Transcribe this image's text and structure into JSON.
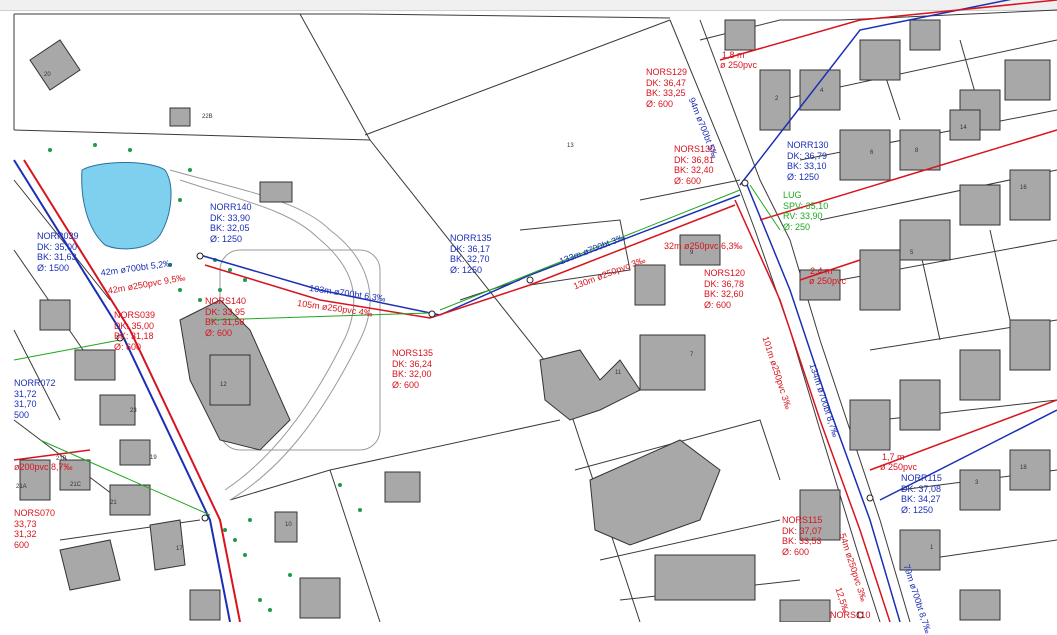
{
  "labels": [
    {
      "id": "norr140",
      "color": "blue",
      "lines": [
        "NORR140",
        "DK: 33,90",
        "BK: 32,05",
        "Ø: 1250"
      ]
    },
    {
      "id": "norr039",
      "color": "blue",
      "lines": [
        "NORR039",
        "DK: 35,00",
        "BK: 31,63",
        "Ø: 1500"
      ]
    },
    {
      "id": "nors140",
      "color": "red",
      "lines": [
        "NORS140",
        "DK: 33,95",
        "BK: 31,58",
        "Ø: 600"
      ]
    },
    {
      "id": "nors039",
      "color": "red",
      "lines": [
        "NORS039",
        "DK: 35,00",
        "BK: 31,18",
        "Ø: 600"
      ]
    },
    {
      "id": "norr072",
      "color": "blue",
      "lines": [
        "NORR072",
        "31,72",
        "31,70",
        "500"
      ]
    },
    {
      "id": "nors070",
      "color": "red",
      "lines": [
        "NORS070",
        "33,73",
        "31,32",
        "600"
      ]
    },
    {
      "id": "norr135",
      "color": "blue",
      "lines": [
        "NORR135",
        "DK: 36,17",
        "BK: 32,70",
        "Ø: 1250"
      ]
    },
    {
      "id": "nors135",
      "color": "red",
      "lines": [
        "NORS135",
        "DK: 36,24",
        "BK: 32,00",
        "Ø: 600"
      ]
    },
    {
      "id": "nors129",
      "color": "red",
      "lines": [
        "NORS129",
        "DK: 36,47",
        "BK: 33,25",
        "Ø: 600"
      ]
    },
    {
      "id": "nors130",
      "color": "red",
      "lines": [
        "NORS130",
        "DK: 36,81",
        "BK: 32,40",
        "Ø: 600"
      ]
    },
    {
      "id": "norr130",
      "color": "blue",
      "lines": [
        "NORR130",
        "DK: 36,79",
        "BK: 33,10",
        "Ø: 1250"
      ]
    },
    {
      "id": "lug",
      "color": "green",
      "lines": [
        "LUG",
        "SPV: 35,10",
        "RV: 33,90",
        "Ø: 250"
      ]
    },
    {
      "id": "nors120",
      "color": "red",
      "lines": [
        "NORS120",
        "DK: 36,78",
        "BK: 32,60",
        "Ø: 600"
      ]
    },
    {
      "id": "nors115",
      "color": "red",
      "lines": [
        "NORS115",
        "DK: 37,07",
        "BK: 33,53",
        "Ø: 600"
      ]
    },
    {
      "id": "norr115",
      "color": "blue",
      "lines": [
        "NORR115",
        "DK: 37,08",
        "BK: 34,27",
        "Ø: 1250"
      ]
    },
    {
      "id": "nors110",
      "color": "red",
      "lines": [
        "NORS110"
      ]
    }
  ],
  "pipe_labels": [
    {
      "id": "p1",
      "color": "blue",
      "text": "42m ø700bt 5,2‰"
    },
    {
      "id": "p2",
      "color": "red",
      "text": "42m ø250pvc 9,5‰"
    },
    {
      "id": "p3",
      "color": "blue",
      "text": "103m ø700bt 6,3‰"
    },
    {
      "id": "p4",
      "color": "red",
      "text": "105m ø250pvc 4‰"
    },
    {
      "id": "p5",
      "color": "blue",
      "text": "133m ø700bt 3‰"
    },
    {
      "id": "p6",
      "color": "red",
      "text": "130m ø250pvc 3‰"
    },
    {
      "id": "p7",
      "color": "red",
      "text": "32m ø250pvc 6,3‰"
    },
    {
      "id": "p8",
      "color": "red",
      "text": "1,8 m"
    },
    {
      "id": "p9",
      "color": "red",
      "text": "ø 250pvc"
    },
    {
      "id": "p10",
      "color": "red",
      "text": "2,4 m"
    },
    {
      "id": "p11",
      "color": "red",
      "text": "ø 250pvc"
    },
    {
      "id": "p12",
      "color": "red",
      "text": "101m ø250pvc 3‰"
    },
    {
      "id": "p13",
      "color": "blue",
      "text": "134m ø700bt 8,7‰"
    },
    {
      "id": "p14",
      "color": "red",
      "text": "1,7 m"
    },
    {
      "id": "p15",
      "color": "red",
      "text": "ø 250pvc"
    },
    {
      "id": "p16",
      "color": "red",
      "text": "ø200pvc 8,7‰"
    },
    {
      "id": "p17",
      "color": "red",
      "text": "54m ø250pvc 3‰"
    },
    {
      "id": "p18",
      "color": "blue",
      "text": "79m ø700bt 8,7‰"
    },
    {
      "id": "p19",
      "color": "blue",
      "text": "94m ø700bt 5‰"
    },
    {
      "id": "p20",
      "color": "red",
      "text": "12,5‰"
    }
  ],
  "house_numbers": [
    "20",
    "22B",
    "13",
    "2",
    "4",
    "6",
    "8",
    "9",
    "7",
    "11",
    "12",
    "10",
    "17",
    "19",
    "21",
    "21A",
    "21B",
    "21C",
    "23",
    "14",
    "16",
    "18",
    "5",
    "3",
    "1"
  ],
  "colors": {
    "sewer": "#d8141e",
    "storm": "#1b2fb5",
    "drain": "#1ea81e",
    "pond": "#7fcfee",
    "building": "#a8a8a8",
    "parcel": "#3a3a3a"
  }
}
